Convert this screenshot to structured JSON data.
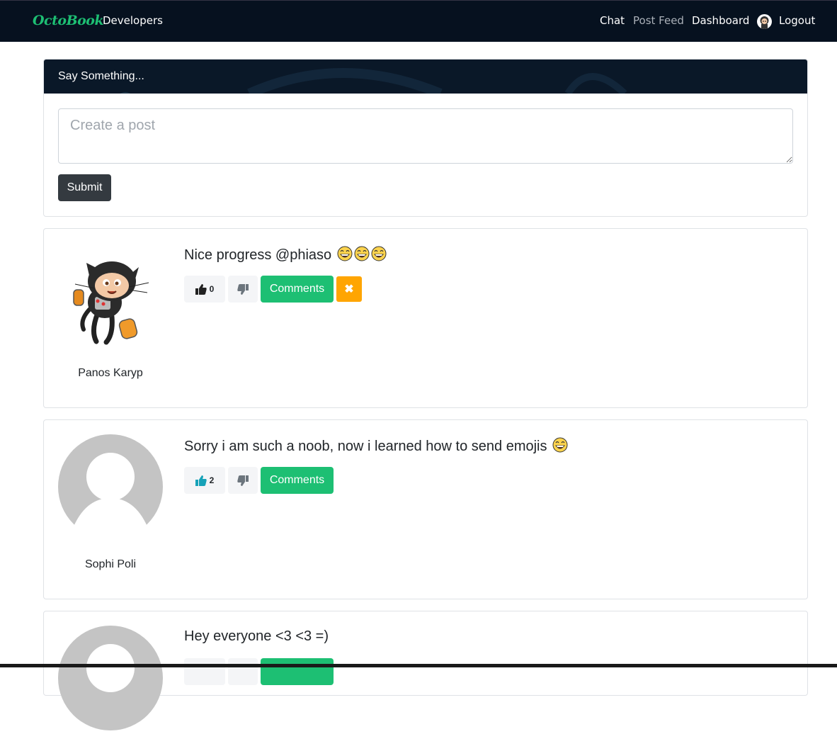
{
  "navbar": {
    "brand": "OctoBook",
    "developers": "Developers",
    "chat": "Chat",
    "post_feed": "Post Feed",
    "dashboard": "Dashboard",
    "logout": "Logout"
  },
  "composer": {
    "header": "Say Something...",
    "placeholder": "Create a post",
    "submit_label": "Submit"
  },
  "posts": [
    {
      "author": "Panos Karyp",
      "text": "Nice progress @phiaso",
      "emoji_count": 3,
      "emoji": "grinning-face-emoji",
      "likes": "0",
      "comments_label": "Comments",
      "delete_icon": "✖",
      "avatar": "octocat-jetpack"
    },
    {
      "author": "Sophi Poli",
      "text": "Sorry i am such a noob, now i learned how to send emojis",
      "emoji_count": 1,
      "emoji": "grinning-face-emoji",
      "likes": "2",
      "comments_label": "Comments",
      "avatar": "default-avatar"
    },
    {
      "text": "Hey everyone <3 <3 =)",
      "avatar": "default-avatar"
    }
  ],
  "colors": {
    "navbar_bg": "#06111f",
    "brand": "#1dbf73",
    "comments_button": "#1dbf73",
    "delete_button": "#ffa502",
    "liked_thumb": "#17a2b8"
  }
}
